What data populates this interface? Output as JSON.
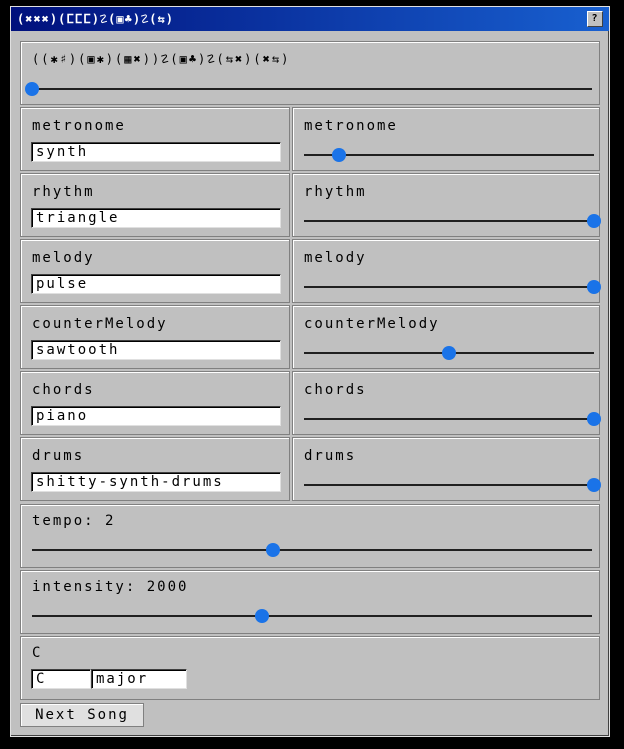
{
  "window": {
    "title": "(✖✖✖)(ⵎⵎⵎ)☡(▣♣)☡(⇆)",
    "help_button": "?"
  },
  "header": {
    "text": "((✱♯)(▣✱)(▦✖))☡(▣♣)☡(⇆✖)(✖⇆)",
    "slider_value": 0
  },
  "tracks": [
    {
      "name": "metronome",
      "instrument": "synth",
      "volume": 0.12
    },
    {
      "name": "rhythm",
      "instrument": "triangle",
      "volume": 1.0
    },
    {
      "name": "melody",
      "instrument": "pulse",
      "volume": 1.0
    },
    {
      "name": "counterMelody",
      "instrument": "sawtooth",
      "volume": 0.5
    },
    {
      "name": "chords",
      "instrument": "piano",
      "volume": 1.0
    },
    {
      "name": "drums",
      "instrument": "shitty-synth-drums",
      "volume": 1.0
    }
  ],
  "tempo": {
    "label": "tempo: 2",
    "fraction": 0.43
  },
  "intensity": {
    "label": "intensity: 2000",
    "fraction": 0.41
  },
  "key": {
    "label": "C",
    "root": "C",
    "mode": "major"
  },
  "next_button": "Next Song",
  "colors": {
    "accent": "#1a73e8",
    "titlebar": "#00107c",
    "face": "#c0c0c0"
  }
}
